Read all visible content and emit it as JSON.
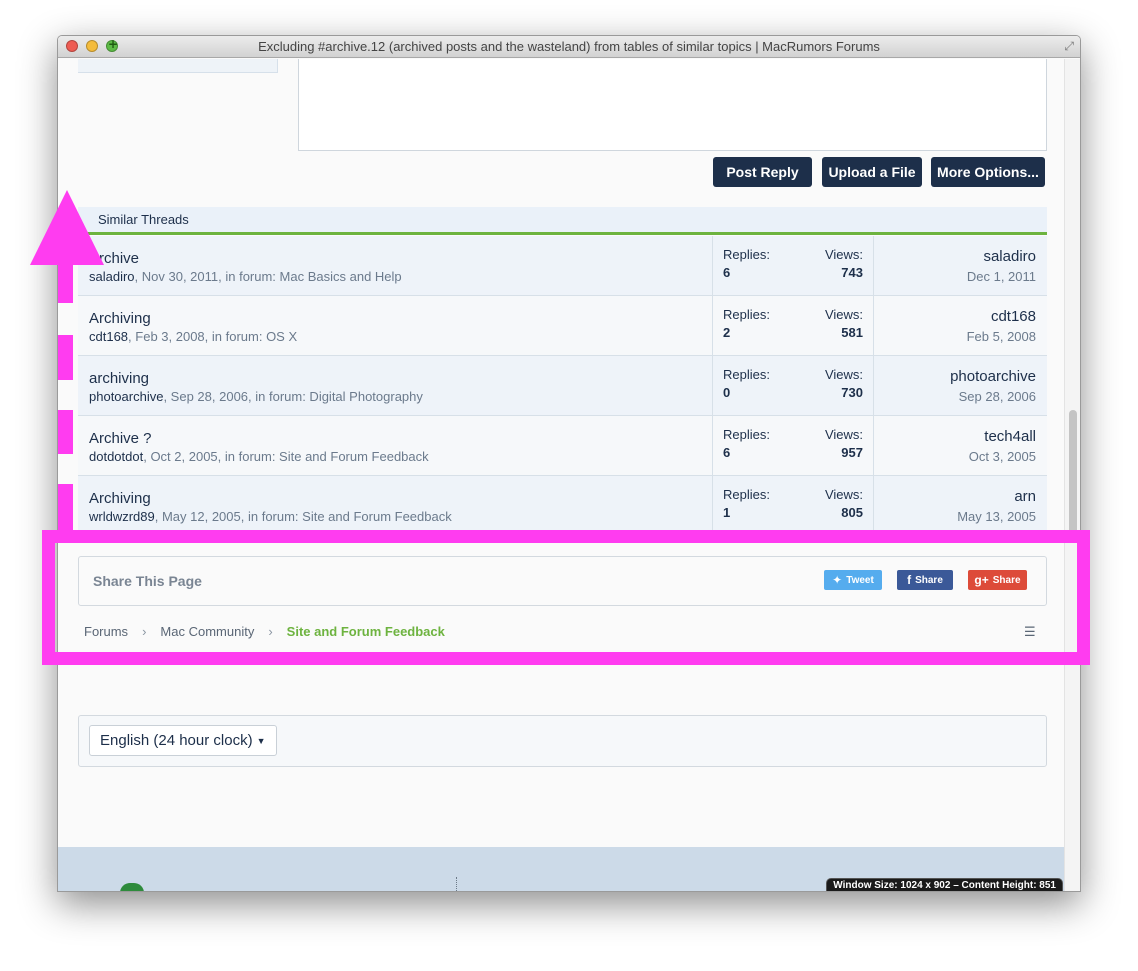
{
  "window": {
    "title": "Excluding #archive.12 (archived posts and the wasteland) from tables of similar topics | MacRumors Forums",
    "fullscreen_icon": "fullscreen-icon"
  },
  "reply": {
    "post_reply": "Post Reply",
    "upload_file": "Upload a File",
    "more_options": "More Options..."
  },
  "similar": {
    "header": "Similar Threads",
    "replies_label": "Replies:",
    "views_label": "Views:",
    "rows": [
      {
        "title": "Archive",
        "user": "saladiro",
        "meta": ", Nov 30, 2011, in forum: Mac Basics and Help",
        "replies": "6",
        "views": "743",
        "last_user": "saladiro",
        "last_date": "Dec 1, 2011"
      },
      {
        "title": "Archiving",
        "user": "cdt168",
        "meta": ", Feb 3, 2008, in forum: OS X",
        "replies": "2",
        "views": "581",
        "last_user": "cdt168",
        "last_date": "Feb 5, 2008"
      },
      {
        "title": "archiving",
        "user": "photoarchive",
        "meta": ", Sep 28, 2006, in forum: Digital Photography",
        "replies": "0",
        "views": "730",
        "last_user": "photoarchive",
        "last_date": "Sep 28, 2006"
      },
      {
        "title": "Archive ?",
        "user": "dotdotdot",
        "meta": ", Oct 2, 2005, in forum: Site and Forum Feedback",
        "replies": "6",
        "views": "957",
        "last_user": "tech4all",
        "last_date": "Oct 3, 2005"
      },
      {
        "title": "Archiving",
        "user": "wrldwzrd89",
        "meta": ", May 12, 2005, in forum: Site and Forum Feedback",
        "replies": "1",
        "views": "805",
        "last_user": "arn",
        "last_date": "May 13, 2005"
      }
    ]
  },
  "share": {
    "title": "Share This Page",
    "tweet": "Tweet",
    "facebook": "Share",
    "google": "Share",
    "colors": {
      "twitter": "#55acee",
      "facebook": "#3b5998",
      "google": "#dd4b39"
    }
  },
  "breadcrumb": {
    "items": [
      "Forums",
      "Mac Community"
    ],
    "current": "Site and Forum Feedback",
    "separator": "›"
  },
  "language": {
    "selected": "English (24 hour clock)"
  },
  "footer": {
    "window_size_badge": "Window Size: 1024 x 902 – Content Height: 851"
  },
  "annotation": {
    "color": "#ff3cf0"
  }
}
